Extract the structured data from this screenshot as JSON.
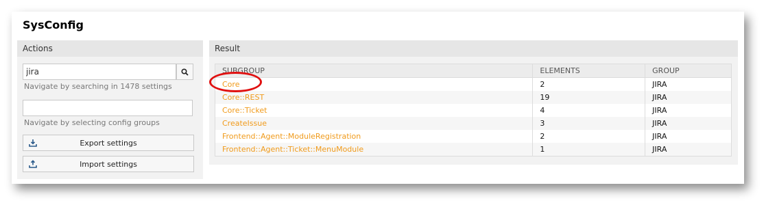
{
  "page": {
    "title": "SysConfig"
  },
  "actions": {
    "header": "Actions",
    "search_value": "jira",
    "search_hint": "Navigate by searching in 1478 settings",
    "group_hint": "Navigate by selecting config groups",
    "export_label": "Export settings",
    "import_label": "Import settings"
  },
  "result": {
    "header": "Result",
    "columns": {
      "subgroup": "SUBGROUP",
      "elements": "ELEMENTS",
      "group": "GROUP"
    },
    "rows": [
      {
        "subgroup": "Core",
        "elements": "2",
        "group": "JIRA"
      },
      {
        "subgroup": "Core::REST",
        "elements": "19",
        "group": "JIRA"
      },
      {
        "subgroup": "Core::Ticket",
        "elements": "4",
        "group": "JIRA"
      },
      {
        "subgroup": "CreateIssue",
        "elements": "3",
        "group": "JIRA"
      },
      {
        "subgroup": "Frontend::Agent::ModuleRegistration",
        "elements": "2",
        "group": "JIRA"
      },
      {
        "subgroup": "Frontend::Agent::Ticket::MenuModule",
        "elements": "1",
        "group": "JIRA"
      }
    ]
  },
  "colors": {
    "link": "#f09a1a",
    "highlight": "#e01010"
  }
}
